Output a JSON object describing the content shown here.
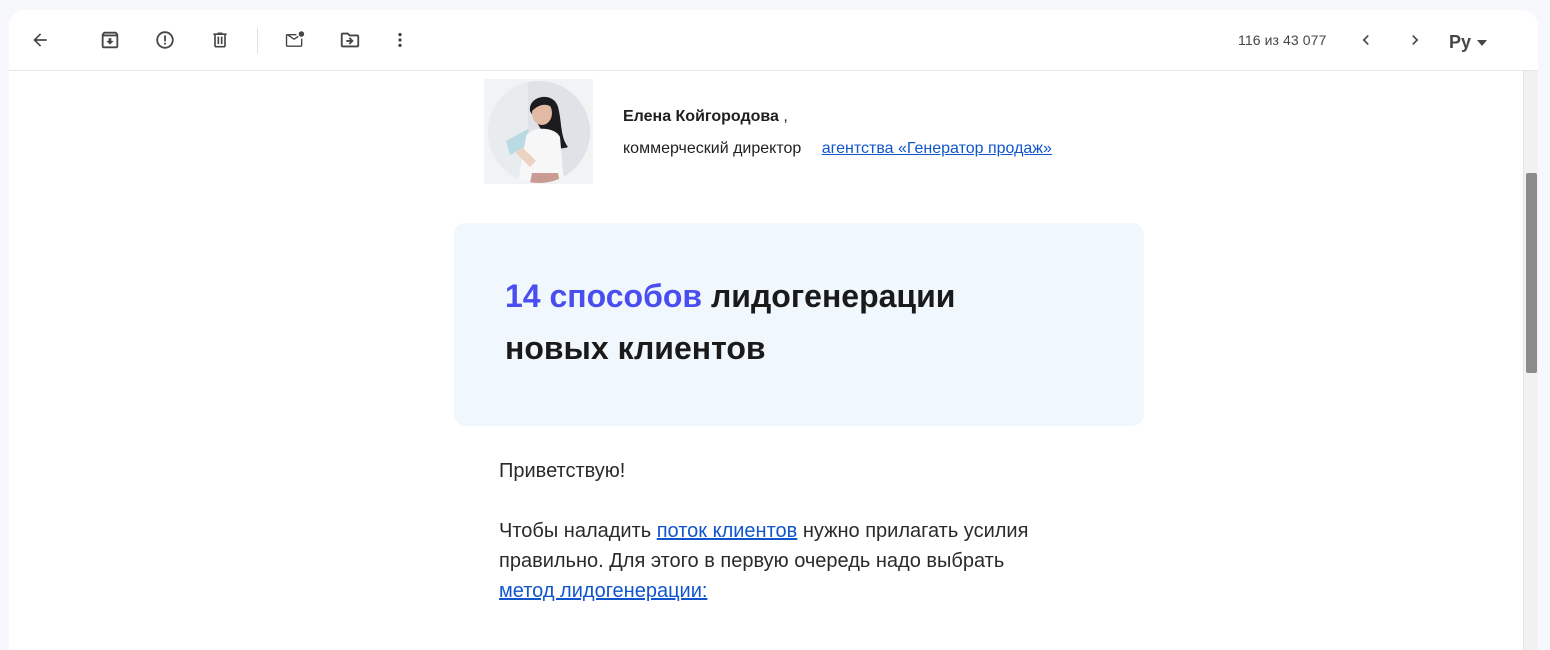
{
  "toolbar": {
    "back_icon": "arrow-back-icon",
    "archive_icon": "archive-icon",
    "spam_icon": "report-spam-icon",
    "delete_icon": "trash-icon",
    "mark_unread_icon": "mark-unread-icon",
    "move_icon": "move-to-folder-icon",
    "more_icon": "more-vert-icon",
    "counter": "116 из 43 077",
    "prev_icon": "chevron-left-icon",
    "next_icon": "chevron-right-icon",
    "language_label": "Ру",
    "language_icon": "caret-down-icon"
  },
  "email": {
    "sender": {
      "name": "Елена Койгородова",
      "name_suffix": ",",
      "role": "коммерческий директор",
      "agency_link": "агентства «Генератор продаж»"
    },
    "banner": {
      "title_accent": "14 способов",
      "title_rest": " лидогенерации новых клиентов",
      "accent_color": "#4a4ef0",
      "background_color": "#f0f7fd"
    },
    "greeting": "Приветствую!",
    "paragraph": {
      "part1": "Чтобы наладить ",
      "link1": "поток клиентов",
      "part2": " нужно прилагать усилия правильно. Для этого в первую очередь надо выбрать ",
      "link2": "метод лидогенерации:"
    }
  },
  "colors": {
    "link": "#1155cc",
    "page_background": "#f6f8fc",
    "text": "#1f1f1f"
  }
}
